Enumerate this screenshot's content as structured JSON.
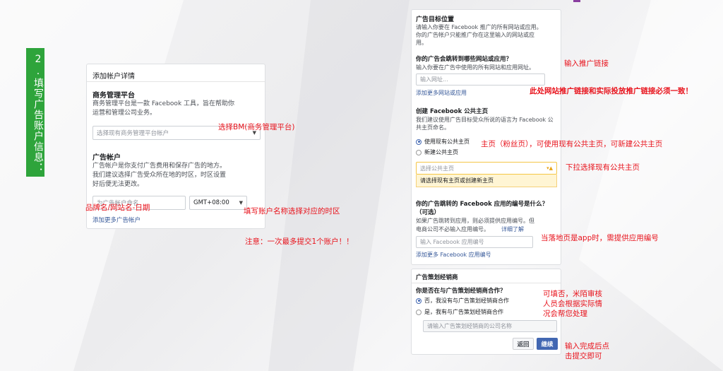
{
  "step_tag": "2.填写广告账户信息：",
  "left_panel": {
    "title": "添加帐户详情",
    "bm_heading": "商务管理平台",
    "bm_desc_line1": "商务管理平台是一款 Facebook 工具，旨在帮助你",
    "bm_desc_line2": "运营和管理公司业务。",
    "bm_select_placeholder": "选择现有商务管理平台帐户",
    "ad_heading": "广告帐户",
    "ad_desc_line1": "广告帐户是你支付广告费用和保存广告的地方。",
    "ad_desc_line2": "我们建议选择广告受众所在地的时区，时区设置",
    "ad_desc_line3": "好后便无法更改。",
    "ad_name_placeholder": "为广告帐户命名",
    "timezone": "GMT+08:00",
    "add_more_link": "添加更多广告帐户"
  },
  "right_panel": {
    "target_heading": "广告目标位置",
    "target_desc_line1": "请输入你要在 Facebook 推广的所有网站或应用。",
    "target_desc_line2": "你的广告帐户只能推广你在这里输入的网站或应",
    "target_desc_line3": "用。",
    "site_question": "你的广告会跳转到哪些网站或应用？",
    "site_desc": "输入你要在广告中使用的所有网站和应用网址。",
    "site_placeholder": "输入网址...",
    "add_site_link": "添加更多网站或应用",
    "page_heading": "创建 Facebook 公共主页",
    "page_desc_line1": "我们建议使用广告目标受众所说的语言为 Facebook 公",
    "page_desc_line2": "共主页命名。",
    "radio_use_existing": "使用现有公共主页",
    "radio_new": "新建公共主页",
    "page_select_placeholder": "选择公共主页",
    "page_warning": "请选择现有主页或创建新主页",
    "app_heading_line1": "你的广告跳转的 Facebook 应用的编号是什么？",
    "app_heading_line2": "（可选）",
    "app_desc_line1": "如果广告跳转到应用，则必须提供应用编号。但",
    "app_desc_line2": "电商公司不必输入应用编号。",
    "app_learn_more": "详细了解",
    "app_placeholder": "输入 Facebook 应用编号",
    "add_app_link": "添加更多 Facebook 应用编号"
  },
  "agency_panel": {
    "heading": "广告策划经销商",
    "question": "你是否在与广告策划经销商合作？",
    "radio_no": "否，我没有与广告策划经销商合作",
    "radio_yes": "是，我有与广告策划经销商合作",
    "agency_placeholder": "请输入广告策划经销商的公司名称",
    "back_button": "返回",
    "next_button": "继续"
  },
  "annotations": {
    "select_bm": "选择BM(商务管理平台)",
    "brand_name": "品牌名/网站名-日期",
    "fill_name_tz": "填写账户名称选择对应的时区",
    "notice": "注意：一次最多提交1个账户！！",
    "enter_link": "输入推广链接",
    "link_consistent": "此处网站推广链接和实际投放推广链接必须一致！",
    "homepage": "主页（粉丝页），可使用现有公共主页，可新建公共主页",
    "dropdown_page": "下拉选择现有公共主页",
    "app_id_note": "当落地页是app时，需提供应用编号",
    "optional_note_line1": "可填否，米陌审核",
    "optional_note_line2": "人员会根据实际情",
    "optional_note_line3": "况会帮您处理",
    "submit_note_line1": "输入完成后点",
    "submit_note_line2": "击提交即可"
  },
  "colors": {
    "step_green": "#2ea43b",
    "annotation_red": "#e8131c",
    "fb_blue": "#4267b2",
    "link_blue": "#365899",
    "warning_yellow": "#fff5d4"
  }
}
